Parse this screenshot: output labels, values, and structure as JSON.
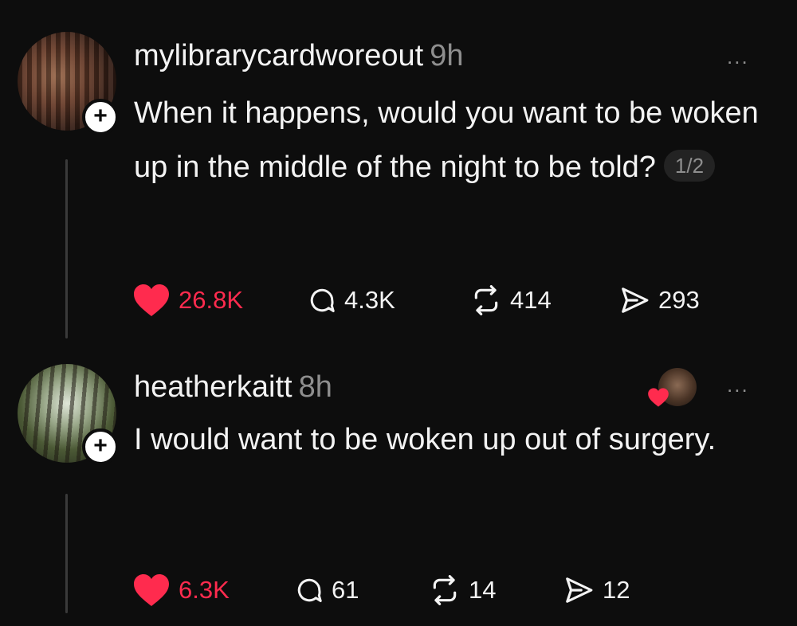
{
  "posts": [
    {
      "username": "mylibrarycardworeout",
      "time": "9h",
      "more": "...",
      "follow_symbol": "+",
      "text": "When it happens, would you want to be woken up in the middle of the night to be told?",
      "counter": "1/2",
      "likes": "26.8K",
      "replies": "4.3K",
      "reposts": "414",
      "shares": "293",
      "liked": true
    },
    {
      "username": "heatherkaitt",
      "time": "8h",
      "more": "...",
      "follow_symbol": "+",
      "text": "I would want to be woken up out of surgery.",
      "likes": "6.3K",
      "replies": "61",
      "reposts": "14",
      "shares": "12",
      "liked": true
    }
  ],
  "colors": {
    "background": "#0d0d0d",
    "like": "#ff2b4e",
    "muted": "#8e8e8e"
  },
  "icons": [
    "heart-icon",
    "comment-icon",
    "repost-icon",
    "share-icon",
    "plus-icon",
    "more-icon"
  ]
}
